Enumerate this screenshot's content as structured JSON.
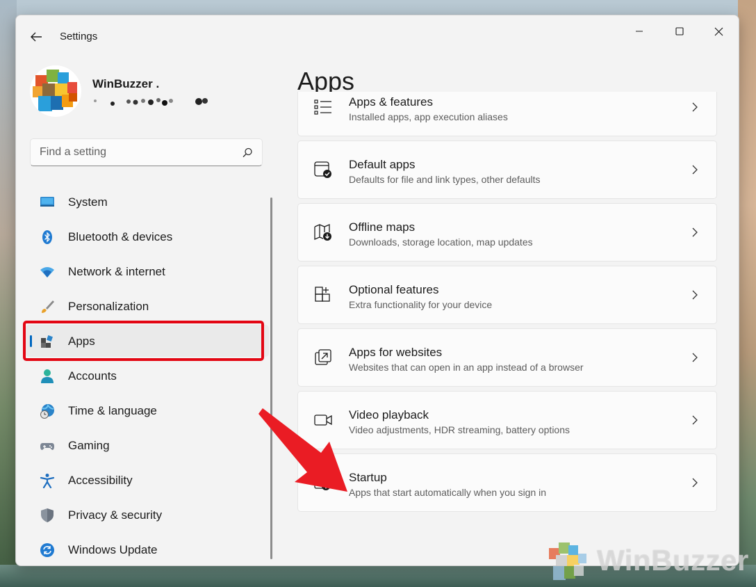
{
  "window": {
    "title": "Settings",
    "controls": {
      "minimize": "minimize-icon",
      "maximize": "maximize-icon",
      "close": "close-icon"
    }
  },
  "profile": {
    "name": "WinBuzzer ."
  },
  "search": {
    "placeholder": "Find a setting"
  },
  "sidebar": {
    "selected_index": 4,
    "items": [
      {
        "label": "System",
        "icon": "monitor-icon"
      },
      {
        "label": "Bluetooth & devices",
        "icon": "bluetooth-icon"
      },
      {
        "label": "Network & internet",
        "icon": "wifi-icon"
      },
      {
        "label": "Personalization",
        "icon": "brush-icon"
      },
      {
        "label": "Apps",
        "icon": "apps-icon"
      },
      {
        "label": "Accounts",
        "icon": "person-icon"
      },
      {
        "label": "Time & language",
        "icon": "globe-clock-icon"
      },
      {
        "label": "Gaming",
        "icon": "gamepad-icon"
      },
      {
        "label": "Accessibility",
        "icon": "accessibility-icon"
      },
      {
        "label": "Privacy & security",
        "icon": "shield-icon"
      },
      {
        "label": "Windows Update",
        "icon": "update-icon"
      }
    ]
  },
  "main": {
    "title": "Apps",
    "cards": [
      {
        "title": "Apps & features",
        "subtitle": "Installed apps, app execution aliases",
        "icon": "list-icon"
      },
      {
        "title": "Default apps",
        "subtitle": "Defaults for file and link types, other defaults",
        "icon": "default-apps-icon"
      },
      {
        "title": "Offline maps",
        "subtitle": "Downloads, storage location, map updates",
        "icon": "map-download-icon"
      },
      {
        "title": "Optional features",
        "subtitle": "Extra functionality for your device",
        "icon": "grid-add-icon"
      },
      {
        "title": "Apps for websites",
        "subtitle": "Websites that can open in an app instead of a browser",
        "icon": "open-in-app-icon"
      },
      {
        "title": "Video playback",
        "subtitle": "Video adjustments, HDR streaming, battery options",
        "icon": "video-icon"
      },
      {
        "title": "Startup",
        "subtitle": "Apps that start automatically when you sign in",
        "icon": "startup-icon"
      }
    ]
  },
  "watermark": {
    "text": "WinBuzzer"
  },
  "colors": {
    "accent": "#0067c0",
    "highlight": "#e30613",
    "arrow": "#ea1c24"
  }
}
